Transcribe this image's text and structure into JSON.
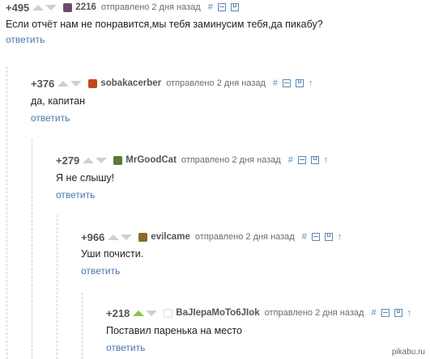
{
  "comments": [
    {
      "rating": "+495",
      "author": "2216",
      "meta": "отправлено 2 дня назад",
      "text": "Если отчёт нам не понравится,мы тебя заминусим тебя,да пикабу?",
      "reply": "ответить",
      "avatar_color": "#6a4c6e",
      "voted_up": false
    },
    {
      "rating": "+376",
      "author": "sobakacerber",
      "meta": "отправлено 2 дня назад",
      "text": "да, капитан",
      "reply": "ответить",
      "avatar_color": "#c2461d",
      "voted_up": false
    },
    {
      "rating": "+279",
      "author": "MrGoodCat",
      "meta": "отправлено 2 дня назад",
      "text": "Я не слышу!",
      "reply": "ответить",
      "avatar_color": "#5a7a3a",
      "voted_up": false
    },
    {
      "rating": "+966",
      "author": "evilcame",
      "meta": "отправлено 2 дня назад",
      "text": "Уши почисти.",
      "reply": "ответить",
      "avatar_color": "#8a6a2a",
      "voted_up": false
    },
    {
      "rating": "+218",
      "author": "BaJIepaMoTo6JIok",
      "meta": "отправлено 2 дня назад",
      "text": "Поставил паренька на место",
      "reply": "ответить",
      "avatar_color": "#ffffff",
      "voted_up": true
    }
  ],
  "tool_icons": [
    "hash-icon",
    "collapse-icon",
    "save-icon",
    "parent-arrow-icon"
  ],
  "colors": {
    "link": "#4a77a8",
    "vote_inactive": "#cfcfcf",
    "vote_active": "#8bc34a",
    "tool": "#5b89b6"
  },
  "watermark": "pikabu.ru"
}
